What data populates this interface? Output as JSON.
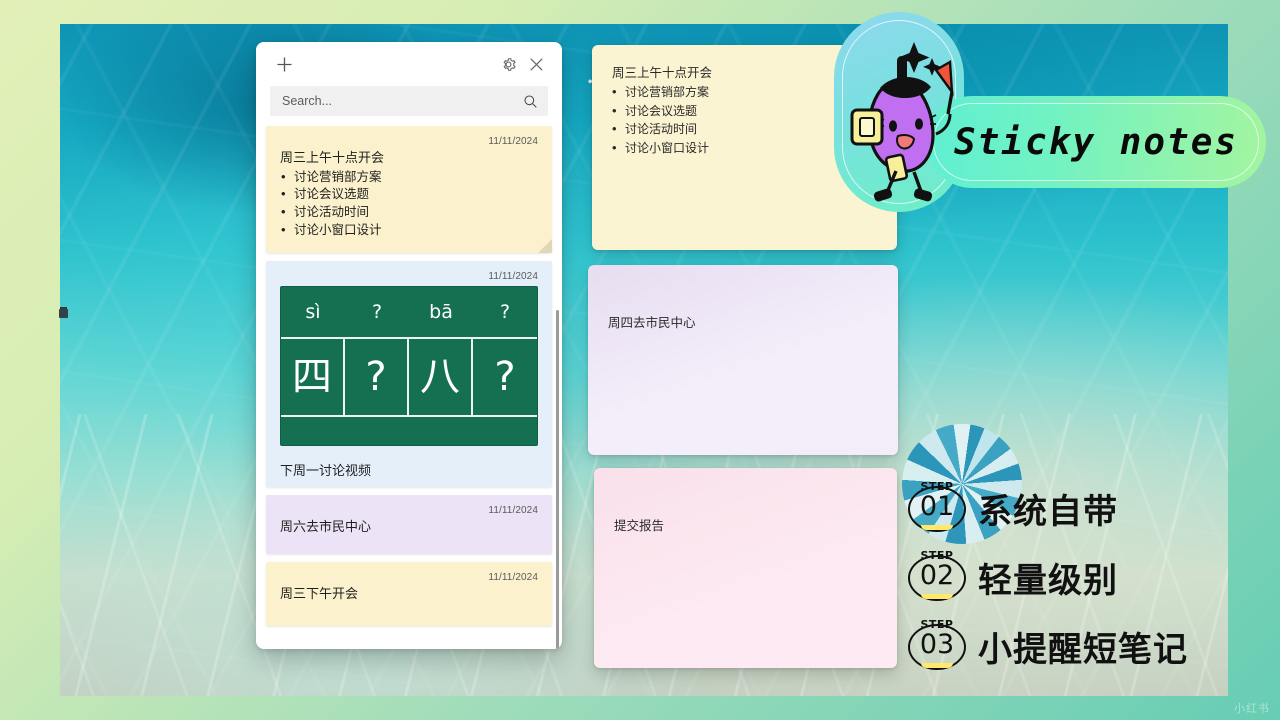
{
  "window": {
    "add_label": "+",
    "settings_label": "Settings",
    "close_label": "Close",
    "search": {
      "value": "",
      "placeholder": "Search..."
    }
  },
  "list_notes": [
    {
      "date": "11/11/2024",
      "title": "周三上午十点开会",
      "bullets": [
        "讨论营销部方案",
        "讨论会议选题",
        "讨论活动时间",
        "讨论小窗口设计"
      ],
      "color": "#fbf2cd",
      "kind": "text"
    },
    {
      "date": "11/11/2024",
      "kind": "image",
      "color": "#e4effa",
      "pinyin": [
        "sì",
        "?",
        "bā",
        "?"
      ],
      "characters": [
        "四",
        "?",
        "八",
        "?"
      ],
      "caption": "下周一讨论视频"
    },
    {
      "date": "11/11/2024",
      "title": "周六去市民中心",
      "bullets": [],
      "color": "#ece3f6",
      "kind": "text"
    },
    {
      "date": "11/11/2024",
      "title": "周三下午开会",
      "bullets": [],
      "color": "#fbf2cd",
      "kind": "text"
    }
  ],
  "float_notes": {
    "yellow": {
      "title": "周三上午十点开会",
      "bullets": [
        "讨论营销部方案",
        "讨论会议选题",
        "讨论活动时间",
        "讨论小窗口设计"
      ],
      "color": "#fbf4d2"
    },
    "purple": {
      "title": "周四去市民中心",
      "color": "#ece3f3"
    },
    "pink": {
      "title": "提交报告",
      "color": "#fbe4ee"
    }
  },
  "badge": {
    "title": "Sticky notes",
    "mascot": "eggplant-mascot"
  },
  "steps": [
    {
      "word": "STEP",
      "number": "01",
      "label": "系统自带"
    },
    {
      "word": "STEP",
      "number": "02",
      "label": "轻量级别"
    },
    {
      "word": "STEP",
      "number": "03",
      "label": "小提醒短笔记"
    }
  ],
  "watermark": "小红书",
  "colors": {
    "accent_green": "#6df0c6",
    "accent_blue": "#1f8fb8",
    "note_yellow": "#fbf4d2",
    "note_purple": "#ece3f3",
    "note_pink": "#fbe4ee",
    "chalkboard": "#147050"
  }
}
